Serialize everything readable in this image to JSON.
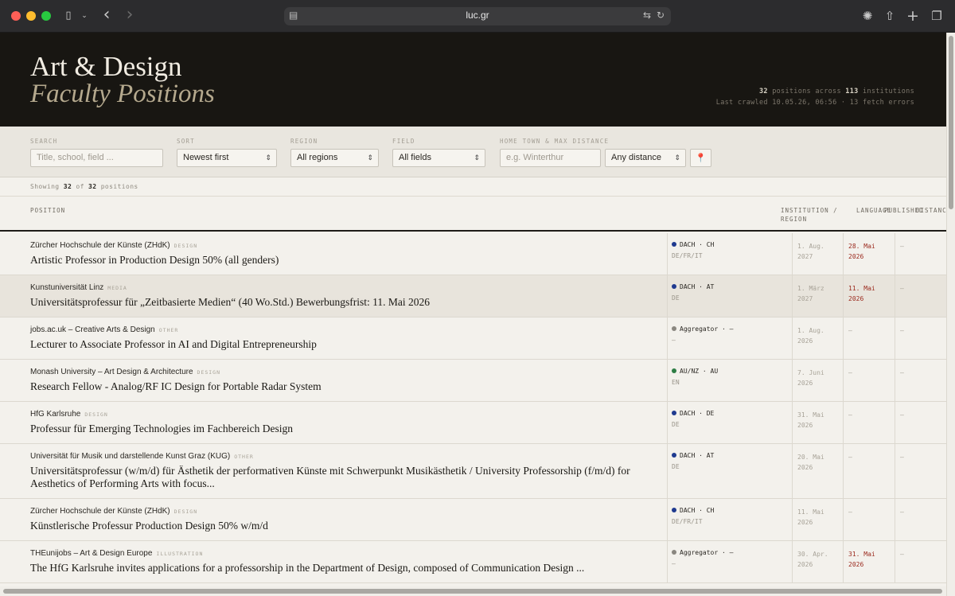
{
  "browser": {
    "url": "luc.gr",
    "controls": {
      "back": "‹",
      "forward": "›",
      "sidebar": "▯",
      "share": "⇧",
      "new_tab": "+",
      "tabs": "❐"
    }
  },
  "hero": {
    "title": "Art & Design",
    "subtitle": "Faculty Positions",
    "positions_count": "32",
    "positions_text": " positions across ",
    "institutions_count": "113",
    "institutions_text": " institutions",
    "crawled": "Last crawled 10.05.26, 06:56 · 13 fetch errors"
  },
  "filters": {
    "search_label": "SEARCH",
    "search_placeholder": "Title, school, field ...",
    "sort_label": "SORT",
    "sort_value": "Newest first",
    "region_label": "REGION",
    "region_value": "All regions",
    "field_label": "FIELD",
    "field_value": "All fields",
    "home_label": "HOME TOWN & MAX DISTANCE",
    "home_placeholder": "e.g. Winterthur",
    "distance_value": "Any distance"
  },
  "showing": {
    "prefix": "Showing ",
    "shown": "32",
    "mid": " of ",
    "total": "32",
    "suffix": " positions"
  },
  "table": {
    "headers": {
      "position": "POSITION",
      "institution_region": "INSTITUTION / REGION",
      "language": "LANGUAGE",
      "published": "PUBLISHED",
      "distance": "DISTANCE"
    },
    "rows": [
      {
        "institution": "Zürcher Hochschule der Künste (ZHdK)",
        "tag": "DESIGN",
        "title": "Artistic Professor in Production Design 50% (all genders)",
        "region": "DACH · CH",
        "region_color": "#1f3a8f",
        "languages": "DE/FR/IT",
        "published": "1. Aug. 2027",
        "deadline": "28. Mai 2026",
        "distance": "—"
      },
      {
        "institution": "Kunstuniversität Linz",
        "tag": "MEDIA",
        "title": "Universitätsprofessur für „Zeitbasierte Medien“ (40 Wo.Std.) Bewerbungsfrist: 11. Mai 2026",
        "region": "DACH · AT",
        "region_color": "#1f3a8f",
        "languages": "DE",
        "published": "1. März 2027",
        "deadline": "11. Mai 2026",
        "distance": "—"
      },
      {
        "institution": "jobs.ac.uk – Creative Arts & Design",
        "tag": "OTHER",
        "title": "Lecturer to Associate Professor in AI and Digital Entrepreneurship",
        "region": "Aggregator · —",
        "region_color": "#8a8780",
        "languages": "—",
        "published": "1. Aug. 2026",
        "deadline": "—",
        "distance": "—"
      },
      {
        "institution": "Monash University – Art Design & Architecture",
        "tag": "DESIGN",
        "title": "Research Fellow - Analog/RF IC Design for Portable Radar System",
        "region": "AU/NZ · AU",
        "region_color": "#2e7d45",
        "languages": "EN",
        "published": "7. Juni 2026",
        "deadline": "—",
        "distance": "—"
      },
      {
        "institution": "HfG Karlsruhe",
        "tag": "DESIGN",
        "title": "Professur für Emerging Technologies im Fachbereich Design",
        "region": "DACH · DE",
        "region_color": "#1f3a8f",
        "languages": "DE",
        "published": "31. Mai 2026",
        "deadline": "—",
        "distance": "—"
      },
      {
        "institution": "Universität für Musik und darstellende Kunst Graz (KUG)",
        "tag": "OTHER",
        "title": "Universitätsprofessur (w/m/d) für Ästhetik der performativen Künste mit Schwerpunkt Musikästhetik / University Professorship (f/m/d) for Aesthetics of Performing Arts with focus...",
        "region": "DACH · AT",
        "region_color": "#1f3a8f",
        "languages": "DE",
        "published": "20. Mai 2026",
        "deadline": "—",
        "distance": "—"
      },
      {
        "institution": "Zürcher Hochschule der Künste (ZHdK)",
        "tag": "DESIGN",
        "title": "Künstlerische Professur Production Design 50% w/m/d",
        "region": "DACH · CH",
        "region_color": "#1f3a8f",
        "languages": "DE/FR/IT",
        "published": "11. Mai 2026",
        "deadline": "—",
        "distance": "—"
      },
      {
        "institution": "THEunijobs – Art & Design Europe",
        "tag": "ILLUSTRATION",
        "title": "The HfG Karlsruhe invites applications for a professorship in the Department of Design, composed of Communication Design ...",
        "region": "Aggregator · —",
        "region_color": "#8a8780",
        "languages": "—",
        "published": "30. Apr. 2026",
        "deadline": "31. Mai 2026",
        "distance": "—"
      }
    ]
  }
}
